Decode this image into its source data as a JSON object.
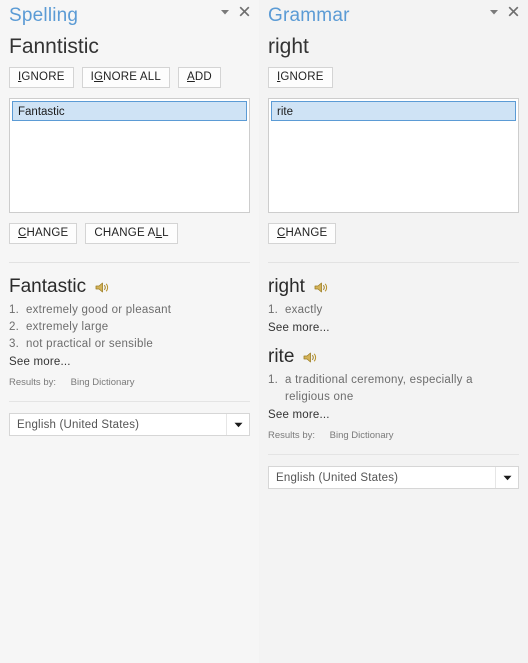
{
  "spelling": {
    "title": "Spelling",
    "controls": {
      "menu": "chevron-down-icon",
      "close": "close-icon"
    },
    "target_word": "Fanntistic",
    "actions": [
      {
        "label": "IGNORE",
        "accel_index": 0
      },
      {
        "label": "IGNORE ALL",
        "accel_index": 1
      },
      {
        "label": "ADD",
        "accel_index": 0
      }
    ],
    "suggestions": [
      {
        "text": "Fantastic",
        "selected": true
      }
    ],
    "change_actions": [
      {
        "label": "CHANGE",
        "accel_index": 0
      },
      {
        "label": "CHANGE ALL",
        "accel_index": 9
      }
    ],
    "definition": {
      "word": "Fantastic",
      "senses": [
        {
          "num": "1.",
          "text": "extremely good or pleasant"
        },
        {
          "num": "2.",
          "text": "extremely large"
        },
        {
          "num": "3.",
          "text": "not practical or sensible"
        }
      ],
      "see_more": "See more...",
      "results_label": "Results by:",
      "results_provider": "Bing Dictionary"
    },
    "language": "English (United States)"
  },
  "grammar": {
    "title": "Grammar",
    "controls": {
      "menu": "chevron-down-icon",
      "close": "close-icon"
    },
    "target_word": "right",
    "actions": [
      {
        "label": "IGNORE",
        "accel_index": 0
      }
    ],
    "suggestions": [
      {
        "text": "rite",
        "selected": true
      }
    ],
    "change_actions": [
      {
        "label": "CHANGE",
        "accel_index": 0
      }
    ],
    "definitions": [
      {
        "word": "right",
        "senses": [
          {
            "num": "1.",
            "text": "exactly"
          }
        ],
        "see_more": "See more..."
      },
      {
        "word": "rite",
        "senses": [
          {
            "num": "1.",
            "text": "a traditional ceremony, especially a religious one"
          }
        ],
        "see_more": "See more..."
      }
    ],
    "results_label": "Results by:",
    "results_provider": "Bing Dictionary",
    "language": "English (United States)"
  },
  "colors": {
    "title_blue": "#5b9bd5",
    "selection_blue": "#cfe3f5",
    "panel_bg": "#f6f6f6",
    "speaker_gold": "#c9a227"
  }
}
